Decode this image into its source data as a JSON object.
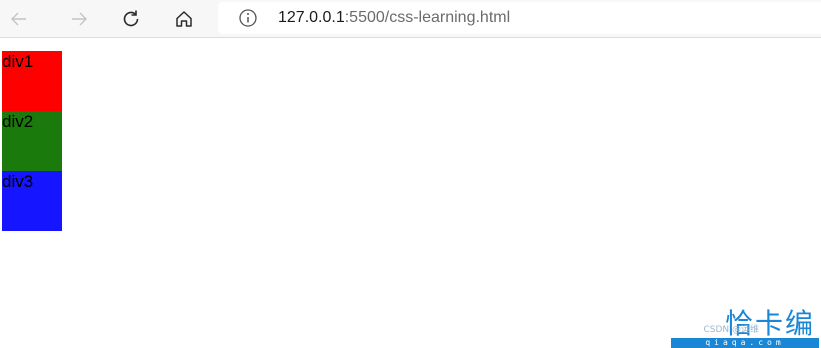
{
  "browser": {
    "url_host": "127.0.0.1",
    "url_rest": ":5500/css-learning.html",
    "icons": {
      "back": "arrow-left-icon",
      "forward": "arrow-right-icon",
      "refresh": "refresh-icon",
      "home": "home-icon",
      "info": "info-icon"
    }
  },
  "page": {
    "boxes": [
      {
        "label": "div1",
        "color": "#ff0000"
      },
      {
        "label": "div2",
        "color": "#1a7a0c"
      },
      {
        "label": "div3",
        "color": "#1515ff"
      }
    ]
  },
  "watermark": {
    "logo": "恰卡编",
    "csdn": "CSDN  @运维",
    "url": "qiaqa.com"
  }
}
